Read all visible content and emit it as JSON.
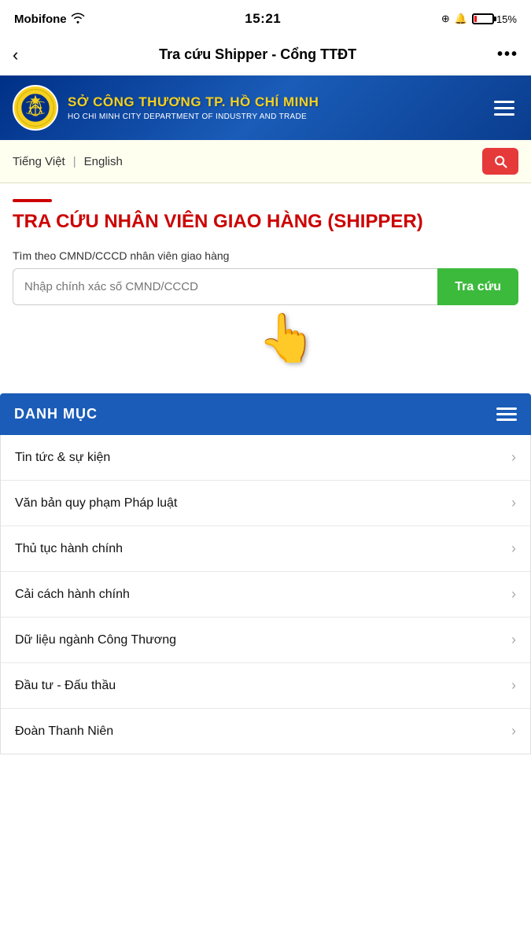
{
  "status_bar": {
    "carrier": "Mobifone",
    "time": "15:21",
    "battery_percent": "15%"
  },
  "nav": {
    "back_label": "‹",
    "title": "Tra cứu Shipper - Cổng TTĐT",
    "more_label": "•••"
  },
  "header": {
    "org_name_viet": "SỞ CÔNG THƯƠNG TP. HỒ CHÍ MINH",
    "org_name_en": "HO CHI MINH CITY DEPARTMENT OF INDUSTRY AND TRADE"
  },
  "language_bar": {
    "viet": "Tiếng Việt",
    "divider": "|",
    "english": "English"
  },
  "main": {
    "page_title": "TRA CỨU NHÂN VIÊN GIAO HÀNG (SHIPPER)",
    "search_label": "Tìm theo CMND/CCCD nhân viên giao hàng",
    "search_placeholder": "Nhập chính xác số CMND/CCCD",
    "search_btn_label": "Tra cứu"
  },
  "danh_muc": {
    "title": "DANH MỤC",
    "items": [
      {
        "label": "Tin tức & sự kiện"
      },
      {
        "label": "Văn bản quy phạm Pháp luật"
      },
      {
        "label": "Thủ tục hành chính"
      },
      {
        "label": "Cải cách hành chính"
      },
      {
        "label": "Dữ liệu ngành Công Thương"
      },
      {
        "label": "Đầu tư - Đấu thầu"
      },
      {
        "label": "Đoàn Thanh Niên"
      }
    ]
  }
}
